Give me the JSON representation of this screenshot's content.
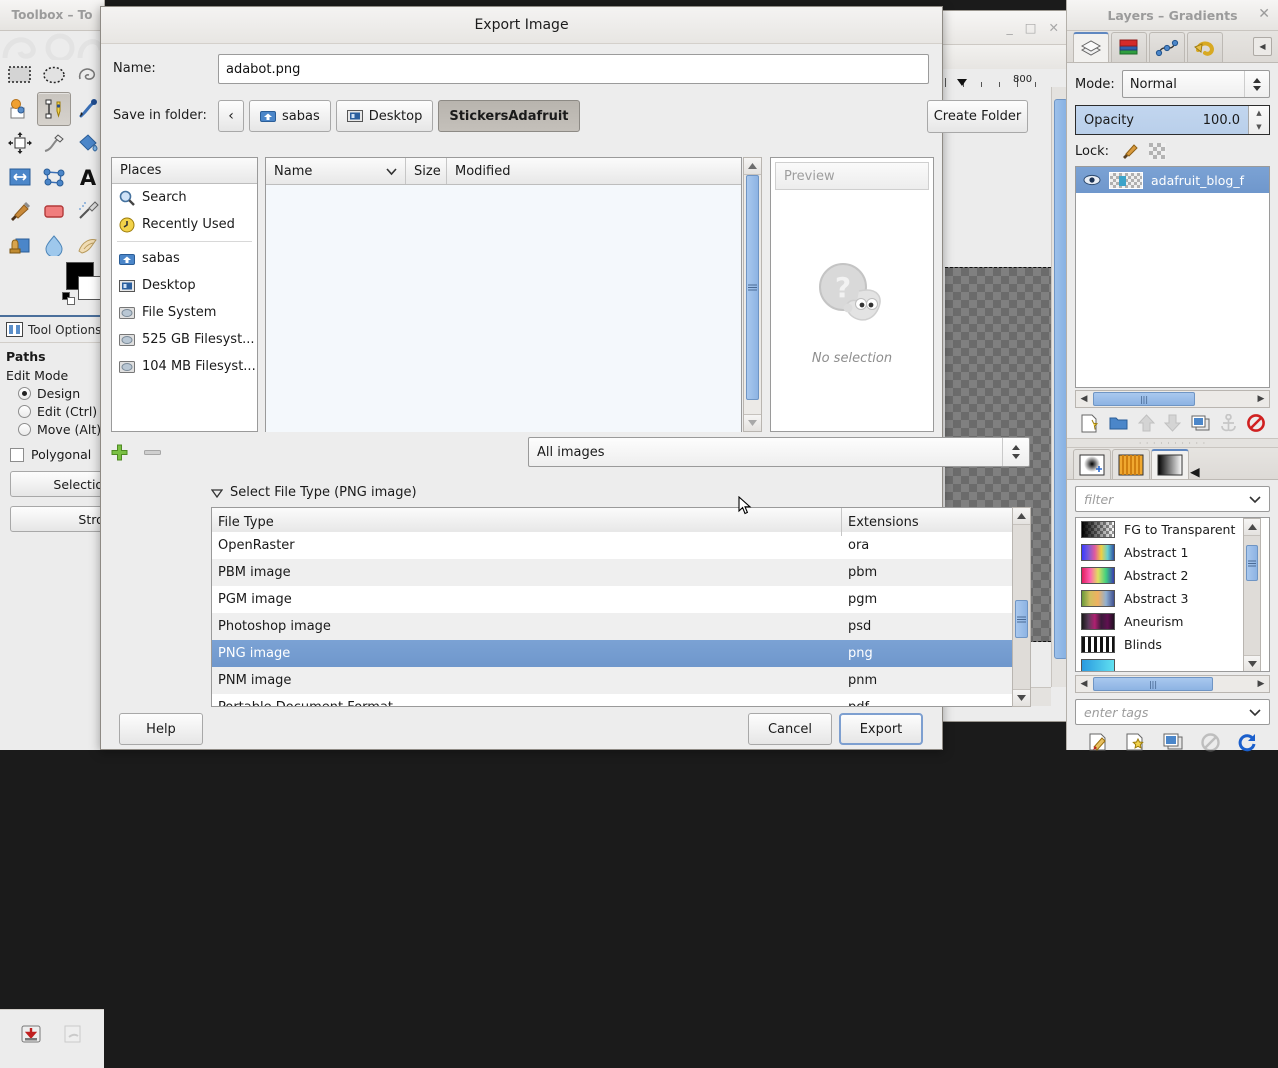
{
  "toolbox": {
    "title": "Toolbox – To",
    "tools": [
      {
        "name": "rect-select-icon",
        "label": "Rectangle Select",
        "active": false
      },
      {
        "name": "ellipse-select-icon",
        "label": "Ellipse Select",
        "active": false
      },
      {
        "name": "free-select-icon",
        "label": "Free Select",
        "active": false
      },
      {
        "name": "fuzzy-select-icon",
        "label": "Fuzzy Select",
        "active": false
      },
      {
        "name": "paths-tool-icon",
        "label": "Paths",
        "active": true
      },
      {
        "name": "color-picker-icon",
        "label": "Color Picker",
        "active": false
      },
      {
        "name": "move-tool-icon",
        "label": "Move",
        "active": false
      },
      {
        "name": "ink-tool-icon",
        "label": "Ink",
        "active": false
      },
      {
        "name": "bucket-fill-icon",
        "label": "Bucket Fill",
        "active": false
      },
      {
        "name": "flip-tool-icon",
        "label": "Flip",
        "active": false
      },
      {
        "name": "cage-transform-icon",
        "label": "Cage Transform",
        "active": false
      },
      {
        "name": "text-tool-icon",
        "label": "Text",
        "active": false
      },
      {
        "name": "paintbrush-icon",
        "label": "Paintbrush",
        "active": false
      },
      {
        "name": "eraser-icon",
        "label": "Eraser",
        "active": false
      },
      {
        "name": "airbrush-icon",
        "label": "Airbrush",
        "active": false
      },
      {
        "name": "clone-tool-icon",
        "label": "Clone",
        "active": false
      },
      {
        "name": "blur-tool-icon",
        "label": "Blur / Sharpen",
        "active": false
      },
      {
        "name": "smudge-tool-icon",
        "label": "Smudge",
        "active": false
      }
    ],
    "foreground_color": "#000000",
    "background_color": "#ffffff"
  },
  "tool_options": {
    "panel_title": "Tool Options",
    "tool_name": "Paths",
    "edit_mode_label": "Edit Mode",
    "modes": [
      {
        "label": "Design",
        "selected": true
      },
      {
        "label": "Edit (Ctrl)",
        "selected": false
      },
      {
        "label": "Move (Alt)",
        "selected": false
      }
    ],
    "polygonal_label": "Polygonal",
    "polygonal_checked": false,
    "selection_button": "Selection",
    "stroke_button": "Strok"
  },
  "image_window": {
    "ruler_label_800": "800",
    "minimize": "_",
    "maximize": "□",
    "close": "✕"
  },
  "dialog": {
    "title": "Export Image",
    "name_label": "Name:",
    "name_value": "adabot.png",
    "folder_label": "Save in folder:",
    "breadcrumbs": [
      {
        "label": "‹",
        "icon": "chevron-left-icon",
        "active": false,
        "is_back": true
      },
      {
        "label": "sabas",
        "icon": "home-folder-icon",
        "active": false
      },
      {
        "label": "Desktop",
        "icon": "desktop-icon",
        "active": false
      },
      {
        "label": "StickersAdafruit",
        "icon": "",
        "active": true
      }
    ],
    "create_folder_label": "Create Folder",
    "places_header": "Places",
    "places": [
      {
        "label": "Search",
        "icon": "search-icon"
      },
      {
        "label": "Recently Used",
        "icon": "recent-icon"
      },
      {
        "label": "sabas",
        "icon": "home-folder-icon"
      },
      {
        "label": "Desktop",
        "icon": "desktop-icon"
      },
      {
        "label": "File System",
        "icon": "drive-icon"
      },
      {
        "label": "525 GB Filesyst...",
        "icon": "drive-icon"
      },
      {
        "label": "104 MB Filesyst...",
        "icon": "drive-icon"
      }
    ],
    "file_columns": [
      "Name",
      "Size",
      "Modified"
    ],
    "files": [],
    "preview_header": "Preview",
    "preview_text": "No selection",
    "filter_value": "All images",
    "expander_label": "Select File Type (PNG image)",
    "file_type_columns": [
      "File Type",
      "Extensions"
    ],
    "file_types": [
      {
        "type": "OpenRaster",
        "ext": "ora",
        "selected": false
      },
      {
        "type": "PBM image",
        "ext": "pbm",
        "selected": false
      },
      {
        "type": "PGM image",
        "ext": "pgm",
        "selected": false
      },
      {
        "type": "Photoshop image",
        "ext": "psd",
        "selected": false
      },
      {
        "type": "PNG image",
        "ext": "png",
        "selected": true
      },
      {
        "type": "PNM image",
        "ext": "pnm",
        "selected": false
      },
      {
        "type": "Portable Document Format",
        "ext": "pdf",
        "selected": false
      }
    ],
    "help_label": "Help",
    "cancel_label": "Cancel",
    "export_label": "Export",
    "accent_color": "#7ba2d4"
  },
  "dock": {
    "title": "Layers – Gradients",
    "close_label": "✕",
    "tabs": [
      {
        "name": "tab-layers",
        "icon": "layers-icon",
        "active": true
      },
      {
        "name": "tab-channels",
        "icon": "channels-icon",
        "active": false
      },
      {
        "name": "tab-paths",
        "icon": "paths-icon",
        "active": false
      },
      {
        "name": "tab-undo-history",
        "icon": "undo-history-icon",
        "active": false
      }
    ],
    "mode_label": "Mode:",
    "mode_value": "Normal",
    "opacity_label": "Opacity",
    "opacity_value": "100.0",
    "lock_label": "Lock:",
    "layers": [
      {
        "name": "adafruit_blog_f",
        "visible": true,
        "selected": true
      }
    ],
    "layer_tools": [
      {
        "name": "new-layer-icon"
      },
      {
        "name": "new-group-icon"
      },
      {
        "name": "raise-layer-icon"
      },
      {
        "name": "lower-layer-icon"
      },
      {
        "name": "duplicate-layer-icon"
      },
      {
        "name": "anchor-layer-icon"
      },
      {
        "name": "delete-layer-icon"
      }
    ],
    "grad_tabs": [
      {
        "name": "tab-brushes",
        "icon": "brush-icon",
        "active": false
      },
      {
        "name": "tab-patterns",
        "icon": "pattern-icon",
        "active": false
      },
      {
        "name": "tab-gradients",
        "icon": "gradient-icon",
        "active": true
      }
    ],
    "filter_placeholder": "filter",
    "gradients": [
      {
        "label": "FG to Transparent",
        "swatch": "fg-transparent"
      },
      {
        "label": "Abstract 1",
        "swatch": "abstract1"
      },
      {
        "label": "Abstract 2",
        "swatch": "abstract2"
      },
      {
        "label": "Abstract 3",
        "swatch": "abstract3"
      },
      {
        "label": "Aneurism",
        "swatch": "aneurism"
      },
      {
        "label": "Blinds",
        "swatch": "blinds"
      }
    ],
    "tags_placeholder": "enter tags",
    "grad_tools": [
      {
        "name": "edit-gradient-icon"
      },
      {
        "name": "new-gradient-icon"
      },
      {
        "name": "duplicate-gradient-icon"
      },
      {
        "name": "delete-gradient-icon"
      },
      {
        "name": "refresh-gradients-icon"
      }
    ]
  }
}
